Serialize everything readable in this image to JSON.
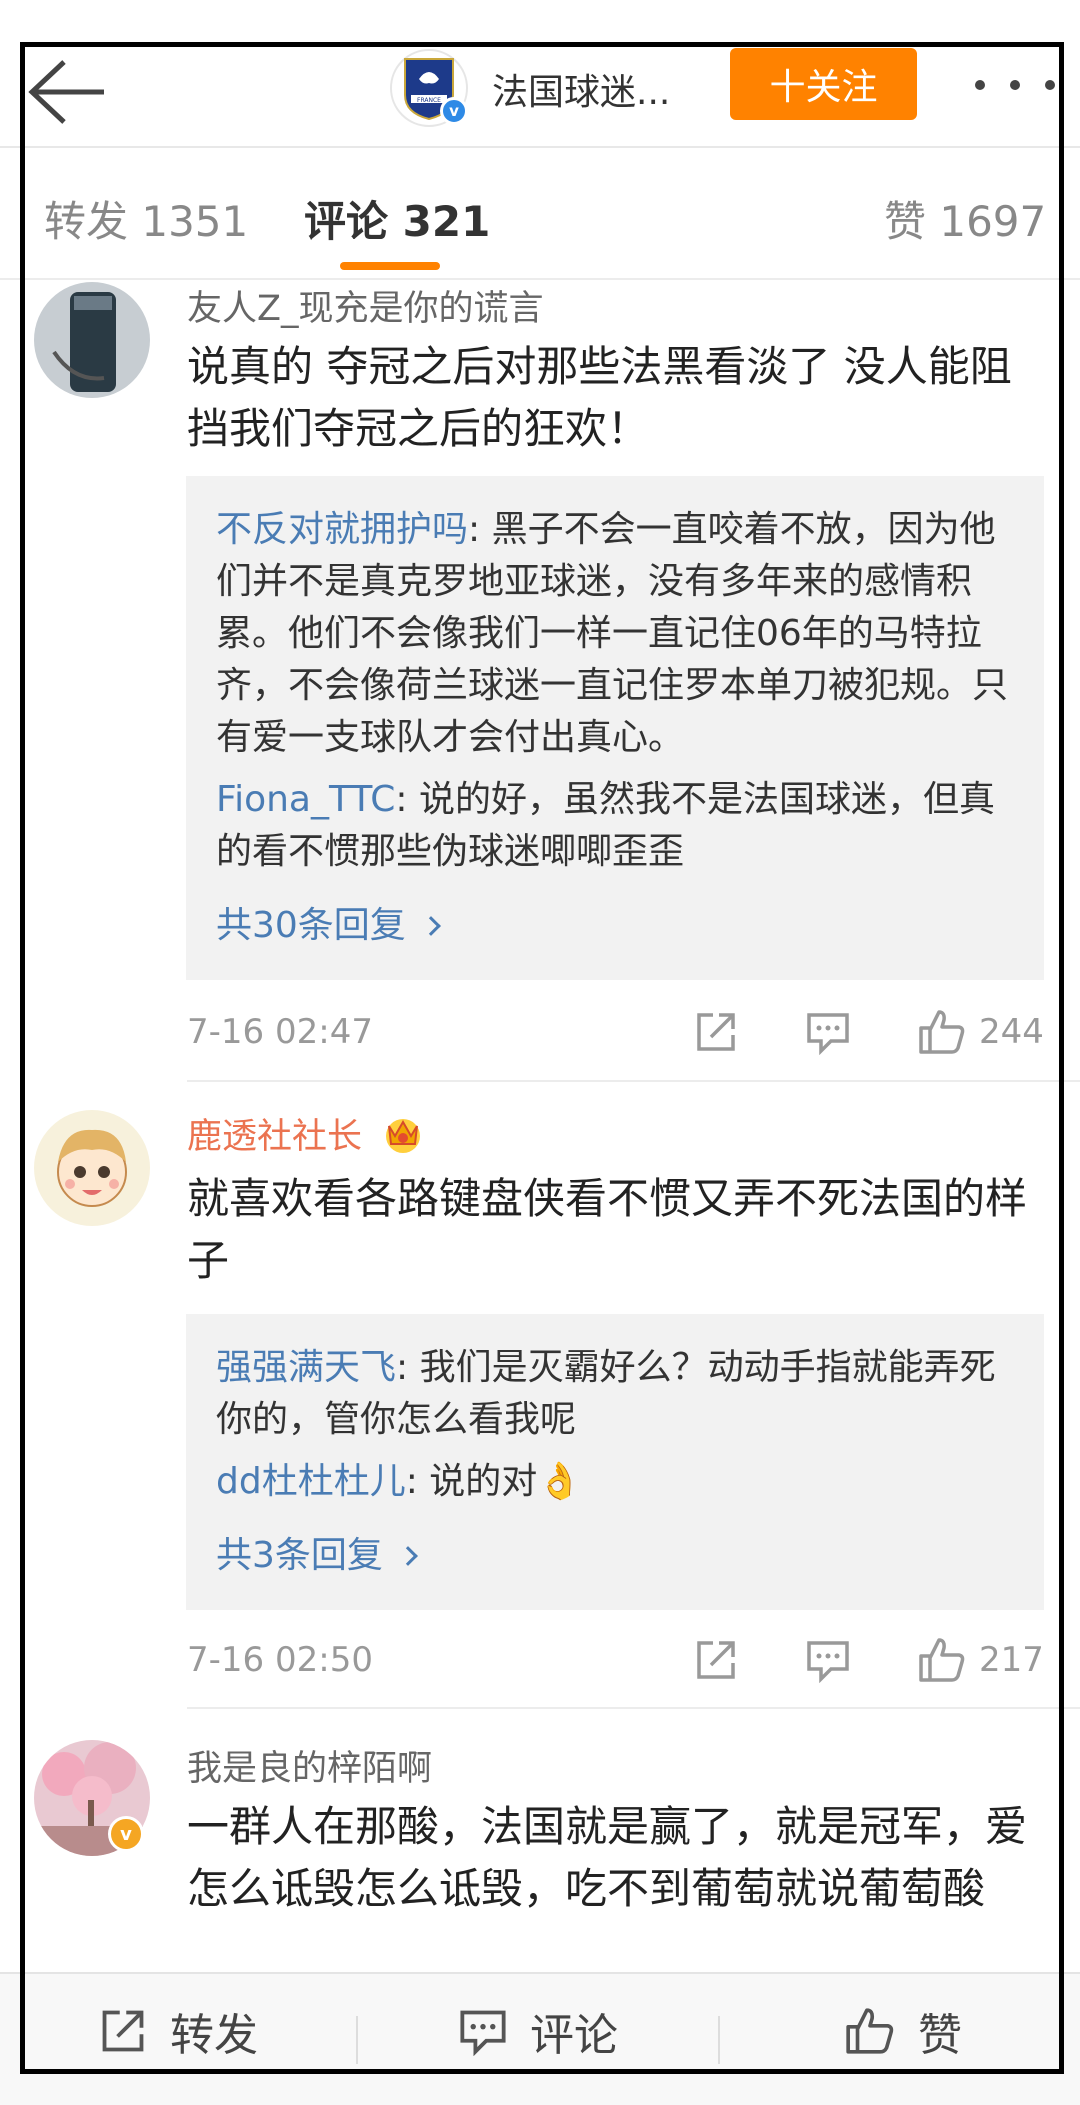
{
  "header": {
    "title": "法国球迷...",
    "follow_label": "十关注",
    "avatar_text": "FRANCE",
    "verified_mark": "v"
  },
  "tabs": [
    {
      "label": "转发 1351"
    },
    {
      "label": "评论 321"
    },
    {
      "label": "赞 1697"
    }
  ],
  "comments": [
    {
      "user": "友人Z_现充是你的谎言",
      "text": "说真的 夺冠之后对那些法黑看淡了 没人能阻挡我们夺冠之后的狂欢！",
      "replies": [
        {
          "user": "不反对就拥护吗",
          "text": ": 黑子不会一直咬着不放，因为他们并不是真克罗地亚球迷，没有多年来的感情积累。他们不会像我们一样一直记住06年的马特拉齐，不会像荷兰球迷一直记住罗本单刀被犯规。只有爱一支球队才会付出真心。"
        },
        {
          "user": "Fiona_TTC",
          "text": ": 说的好，虽然我不是法国球迷，但真的看不惯那些伪球迷唧唧歪歪"
        }
      ],
      "more": "共30条回复",
      "time": "7-16 02:47",
      "likes": "244"
    },
    {
      "user": "鹿透社社长",
      "text": "就喜欢看各路键盘侠看不惯又弄不死法国的样子",
      "replies": [
        {
          "user": "强强满天飞",
          "text": ": 我们是灭霸好么？动动手指就能弄死你的，管你怎么看我呢"
        },
        {
          "user": "dd杜杜杜儿",
          "text": ": 说的对👌"
        }
      ],
      "more": "共3条回复",
      "time": "7-16 02:50",
      "likes": "217"
    },
    {
      "user": "我是良的梓陌啊",
      "text": "一群人在那酸，法国就是赢了，就是冠军，爱怎么诋毁怎么诋毁，吃不到葡萄就说葡萄酸"
    }
  ],
  "bottom_bar": {
    "repost": "转发",
    "comment": "评论",
    "like": "赞"
  },
  "colors": {
    "accent": "#ff8200",
    "link": "#4a7cb4",
    "vip_name": "#eb7350"
  }
}
